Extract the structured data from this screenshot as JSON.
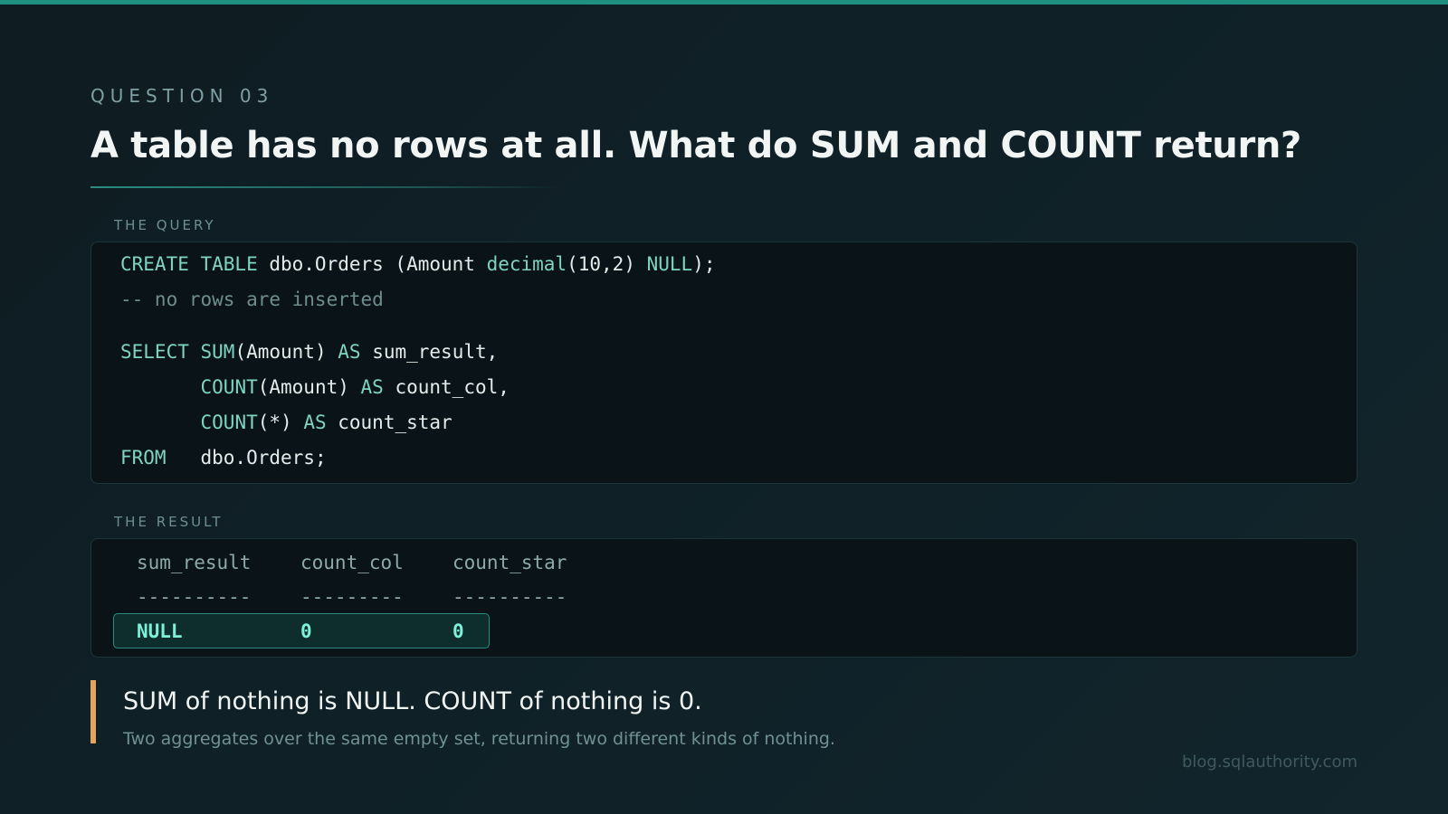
{
  "eyebrow": "QUESTION 03",
  "title": "A table has no rows at all. What do SUM and COUNT return?",
  "query_section": {
    "label": "THE QUERY",
    "lines": [
      [
        {
          "t": "CREATE TABLE",
          "k": "kw"
        },
        {
          "t": " dbo.Orders (Amount "
        },
        {
          "t": "decimal",
          "k": "kw"
        },
        {
          "t": "(10,2) "
        },
        {
          "t": "NULL",
          "k": "kw"
        },
        {
          "t": ");"
        }
      ],
      [
        {
          "t": "-- no rows are inserted",
          "k": "cm"
        }
      ],
      [
        {
          "t": "SELECT",
          "k": "kw"
        },
        {
          "t": " "
        },
        {
          "t": "SUM",
          "k": "kw"
        },
        {
          "t": "(Amount) "
        },
        {
          "t": "AS",
          "k": "kw"
        },
        {
          "t": " sum_result,"
        }
      ],
      [
        {
          "t": "       "
        },
        {
          "t": "COUNT",
          "k": "kw"
        },
        {
          "t": "(Amount) "
        },
        {
          "t": "AS",
          "k": "kw"
        },
        {
          "t": " count_col,"
        }
      ],
      [
        {
          "t": "       "
        },
        {
          "t": "COUNT",
          "k": "kw"
        },
        {
          "t": "(*) "
        },
        {
          "t": "AS",
          "k": "kw"
        },
        {
          "t": " count_star"
        }
      ],
      [
        {
          "t": "FROM",
          "k": "kw"
        },
        {
          "t": "   dbo.Orders;"
        }
      ]
    ]
  },
  "result_section": {
    "label": "THE RESULT",
    "columns": [
      "sum_result",
      "count_col",
      "count_star"
    ],
    "separators": [
      "----------",
      "---------",
      "----------"
    ],
    "values": [
      "NULL",
      "0",
      "0"
    ]
  },
  "takeaway": {
    "main": "SUM of nothing is NULL. COUNT of nothing is 0.",
    "sub": "Two aggregates over the same empty set, returning two different kinds of nothing."
  },
  "footer": "blog.sqlauthority.com",
  "colors": {
    "accent": "#1f8f80",
    "keyword": "#7ed3c2",
    "highlight": "#7ff0d8",
    "takeaway_bar": "#e2a55d"
  }
}
